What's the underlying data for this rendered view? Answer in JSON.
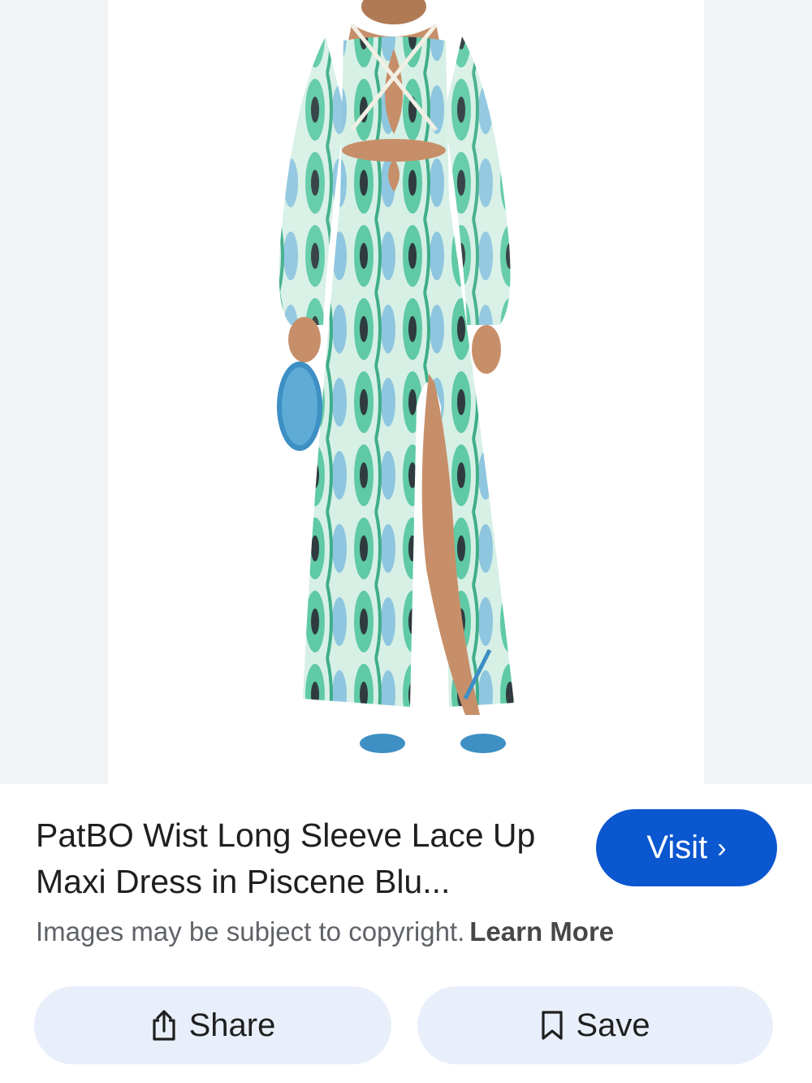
{
  "result": {
    "title": "PatBO Wist Long Sleeve Lace Up Maxi Dress in Piscene Blu...",
    "visit_label": "Visit",
    "visit_chevron": "›"
  },
  "notice": {
    "text": "Images may be subject to copyright.",
    "link": "Learn More"
  },
  "actions": {
    "share_label": "Share",
    "save_label": "Save"
  },
  "icons": {
    "visit": "chevron-right-icon",
    "share": "share-icon",
    "save": "bookmark-icon"
  },
  "colors": {
    "primary": "#0b57d0",
    "action_bg": "#e8effa",
    "dress_green": "#5fcaa5",
    "dress_blue": "#8fc6df"
  }
}
